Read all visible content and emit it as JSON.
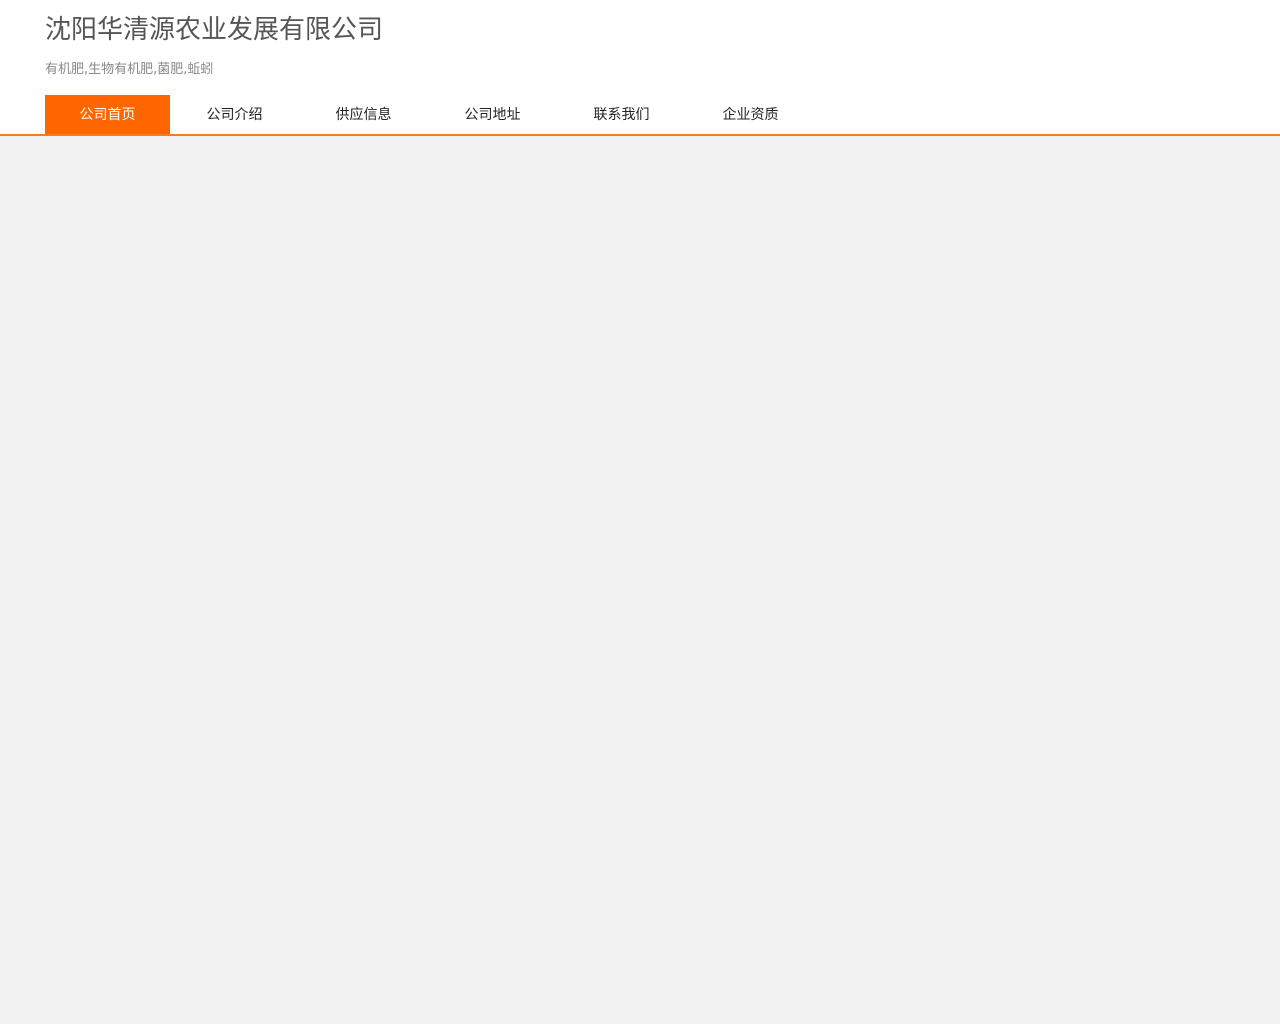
{
  "header": {
    "title": "沈阳华清源农业发展有限公司",
    "tagline": "有机肥,生物有机肥,菌肥,蚯蚓"
  },
  "nav": {
    "items": [
      {
        "label": "公司首页",
        "active": true
      },
      {
        "label": "公司介绍"
      },
      {
        "label": "供应信息"
      },
      {
        "label": "公司地址"
      },
      {
        "label": "联系我们"
      },
      {
        "label": "企业资质"
      }
    ]
  },
  "colors": {
    "accent": "#ff6600",
    "nav_border": "#f07f1e",
    "page_background": "#f2f2f2"
  }
}
